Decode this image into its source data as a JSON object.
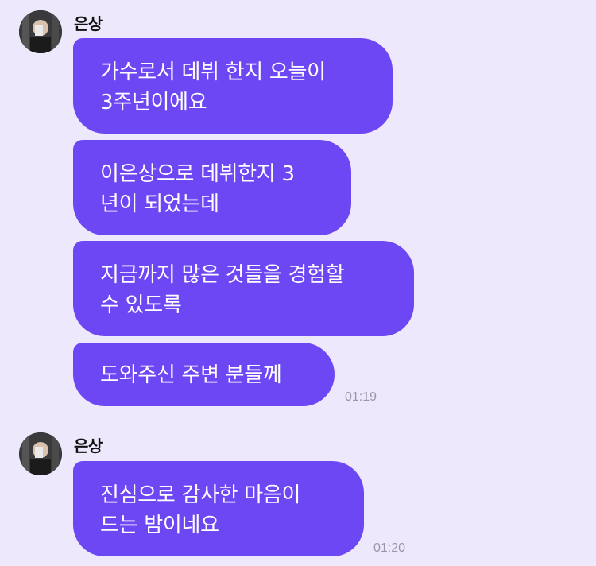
{
  "groups": [
    {
      "sender": "은상",
      "avatar_icon": "profile-photo-icon",
      "messages": [
        {
          "lines": [
            "가수로서 데뷔 한지 오늘이",
            "3주년이에요"
          ]
        },
        {
          "lines": [
            "이은상으로 데뷔한지 3",
            "년이 되었는데"
          ]
        },
        {
          "lines": [
            "지금까지 많은 것들을 경험할",
            "수 있도록"
          ]
        },
        {
          "lines": [
            "도와주신 주변 분들께"
          ]
        }
      ],
      "timestamp": "01:19"
    },
    {
      "sender": "은상",
      "avatar_icon": "profile-photo-icon",
      "messages": [
        {
          "lines": [
            "진심으로 감사한 마음이",
            "드는 밤이네요"
          ]
        }
      ],
      "timestamp": "01:20"
    }
  ],
  "colors": {
    "background": "#ede8fb",
    "bubble": "#6d47f4",
    "bubble_text": "#ffffff",
    "timestamp": "#9a97a6"
  }
}
